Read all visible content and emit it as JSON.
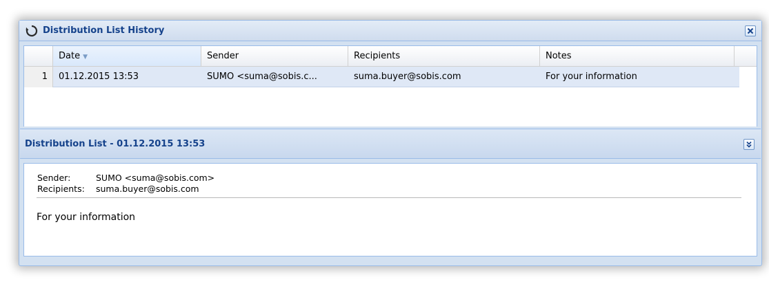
{
  "window": {
    "title": "Distribution List History",
    "accent": "#15428b"
  },
  "grid": {
    "columns": [
      "Date",
      "Sender",
      "Recipients",
      "Notes"
    ],
    "sorted_column": "Date",
    "sort_direction": "descending",
    "rows": [
      {
        "num": "1",
        "date": "01.12.2015 13:53",
        "sender": "SUMO <suma@sobis.c...",
        "recipients": "suma.buyer@sobis.com",
        "notes": "For your information"
      }
    ]
  },
  "detail": {
    "title": "Distribution List - 01.12.2015 13:53",
    "sender_label": "Sender:",
    "sender_value": "SUMO <suma@sobis.com>",
    "recipients_label": "Recipients:",
    "recipients_value": "suma.buyer@sobis.com",
    "notes": "For your information"
  },
  "icons": {
    "window": "refresh-history-icon",
    "close": "close-icon",
    "collapse": "collapse-down-icon",
    "sort": "sort-down-arrow-icon"
  }
}
